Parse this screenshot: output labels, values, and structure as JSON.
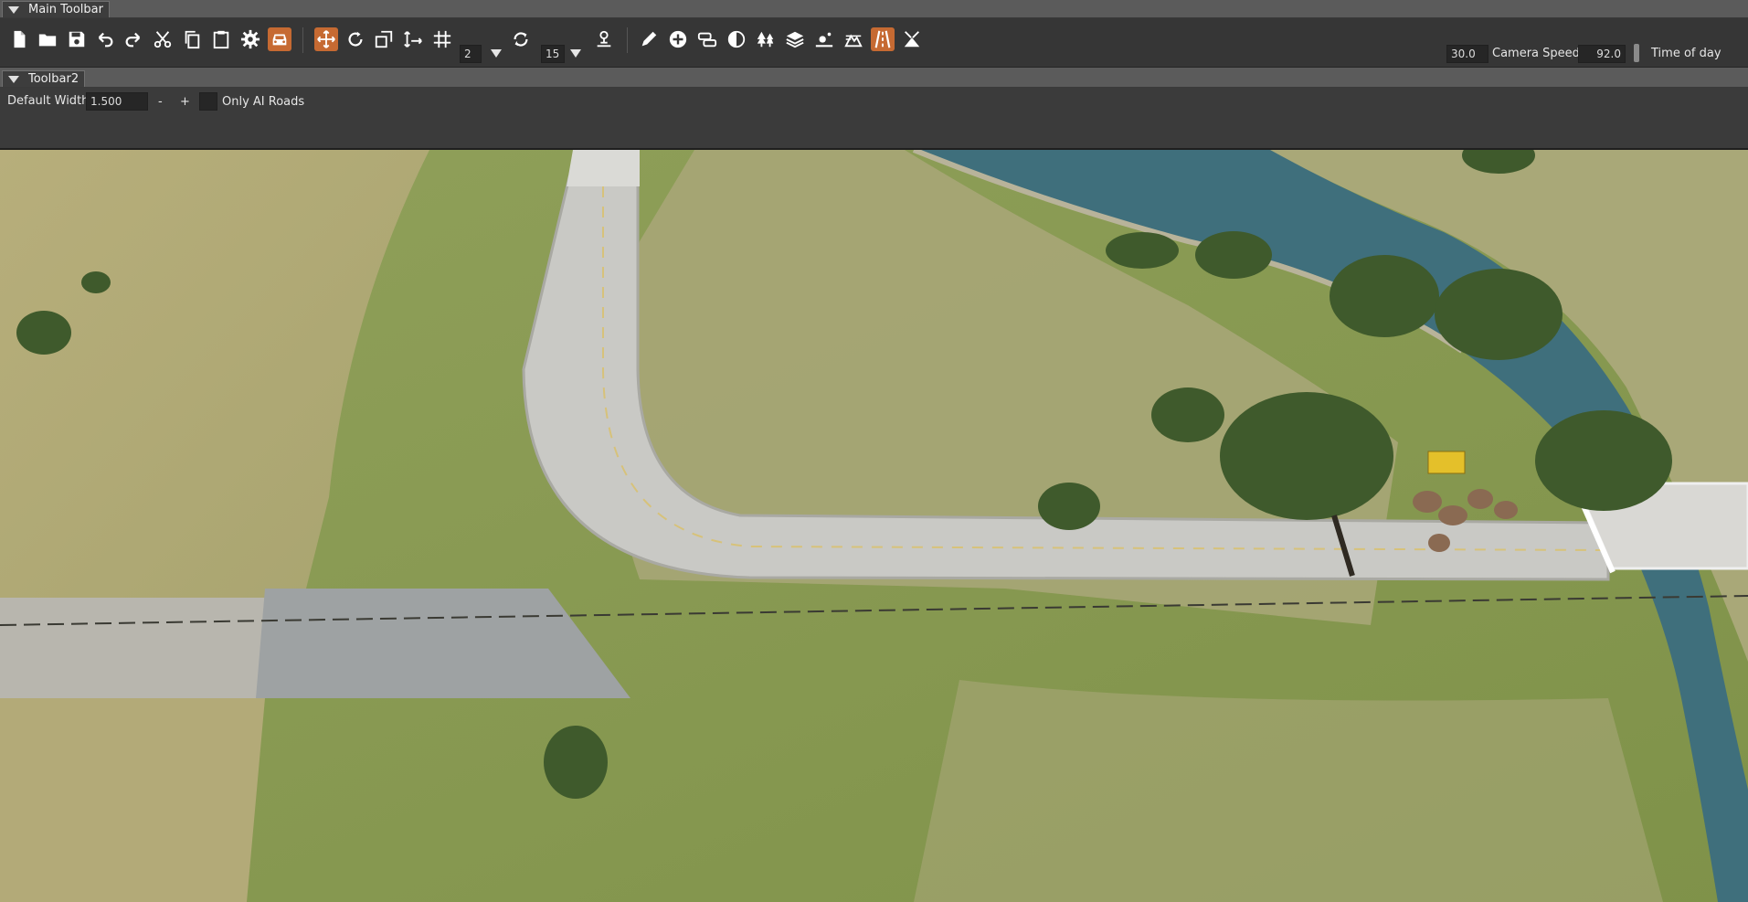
{
  "main_toolbar": {
    "title": "Main Toolbar",
    "snap_value": "2",
    "rotate_snap_value": "15",
    "camera_speed_value": "30.0",
    "camera_speed_label": "Camera Speed",
    "time_of_day_value": "92.0",
    "time_of_day_label": "Time of day"
  },
  "toolbar2": {
    "title": "Toolbar2",
    "default_width_label": "Default Width",
    "default_width_value": "1.500",
    "decrement_label": "-",
    "increment_label": "+",
    "only_ai_roads_label": "Only AI Roads",
    "only_ai_roads_checked": false
  },
  "colors": {
    "accent_orange": "#c66a32",
    "toolbar_bg": "#363636",
    "water": "#3f6f7c",
    "grass": "#8f9a55"
  },
  "icons": {
    "file_tools": [
      "new-file-icon",
      "open-folder-icon",
      "save-icon",
      "undo-icon",
      "redo-icon",
      "cut-icon",
      "copy-icon",
      "paste-icon",
      "settings-gear-icon",
      "vehicle-icon"
    ],
    "transform_tools": [
      "move-icon",
      "rotate-icon",
      "scale-icon",
      "translate-axis-icon",
      "grid-snap-icon",
      "rotate-snap-icon",
      "terrain-snap-icon"
    ],
    "editor_tools": [
      "pencil-icon",
      "add-circle-icon",
      "road-node-icon",
      "decal-icon",
      "forest-icon",
      "layers-icon",
      "object-drop-icon",
      "terrain-paint-icon",
      "road-icon",
      "mesh-road-icon"
    ]
  }
}
